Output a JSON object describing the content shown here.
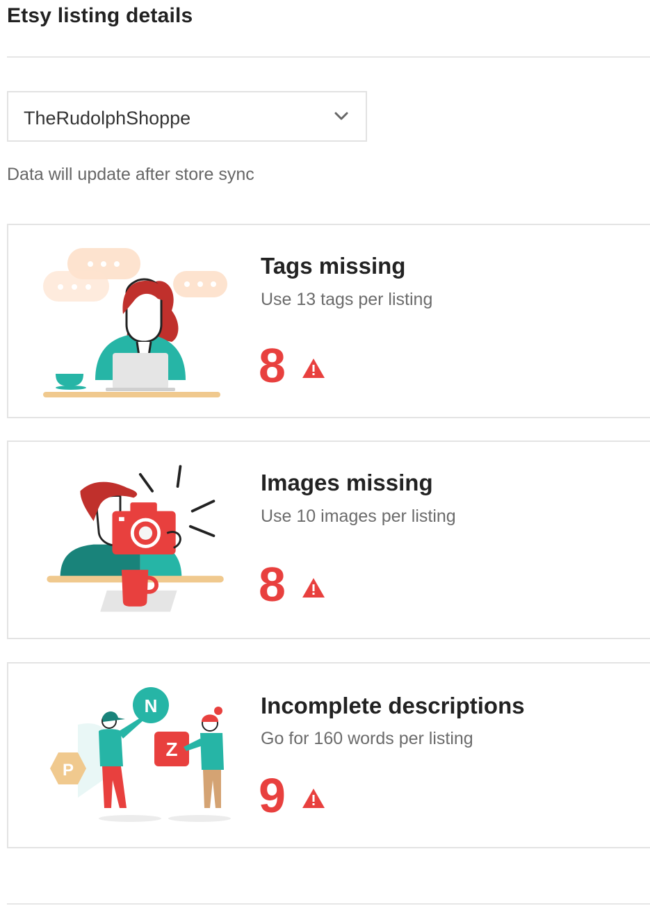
{
  "header": {
    "title": "Etsy listing details"
  },
  "store_selector": {
    "selected": "TheRudolphShoppe",
    "icon": "chevron-down-icon"
  },
  "sync_note": "Data will update after store sync",
  "cards": [
    {
      "title": "Tags missing",
      "subtitle": "Use 13 tags per listing",
      "count": "8",
      "icon": "warning-icon"
    },
    {
      "title": "Images missing",
      "subtitle": "Use 10 images per listing",
      "count": "8",
      "icon": "warning-icon"
    },
    {
      "title": "Incomplete descriptions",
      "subtitle": "Go for 160 words per listing",
      "count": "9",
      "icon": "warning-icon"
    }
  ],
  "illustration_text": {
    "badge_n": "N",
    "badge_z": "Z",
    "badge_p": "P"
  },
  "colors": {
    "accent_red": "#e8403e",
    "teal": "#26b5a6",
    "peach": "#fde3cf",
    "tan": "#f0c98e"
  }
}
